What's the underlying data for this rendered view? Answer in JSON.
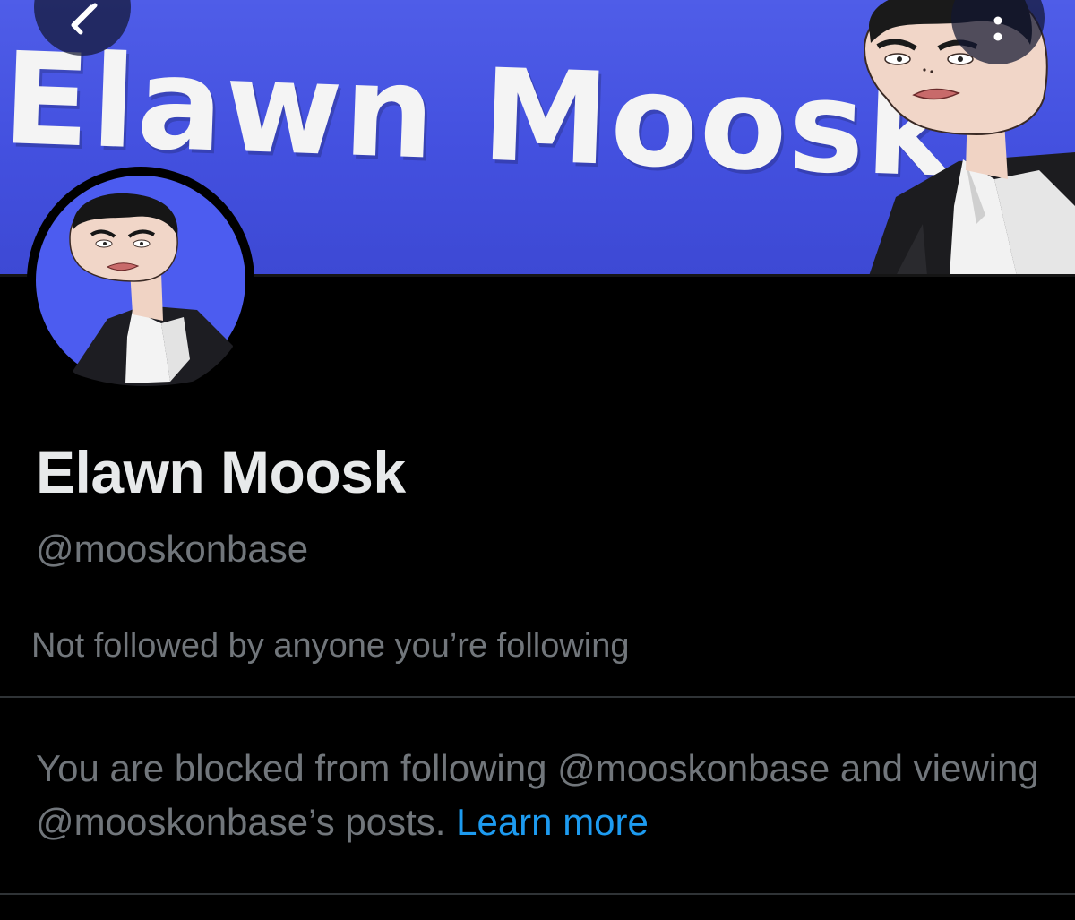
{
  "banner": {
    "title": "Elawn Moosk",
    "background_color": "#4a57e3"
  },
  "nav": {
    "back_icon": "back-arrow-icon",
    "more_icon": "more-vertical-icon"
  },
  "profile": {
    "display_name": "Elawn Moosk",
    "handle": "@mooskonbase",
    "followed_by": "Not followed by anyone you’re following"
  },
  "blocked": {
    "message": "You are blocked from following @mooskonbase and viewing @mooskonbase’s posts.",
    "link_label": "Learn more",
    "link_color": "#1d9bf0"
  },
  "colors": {
    "background": "#000000",
    "primary_text": "#e7e9ea",
    "secondary_text": "#71767b",
    "divider": "#2f3336"
  }
}
